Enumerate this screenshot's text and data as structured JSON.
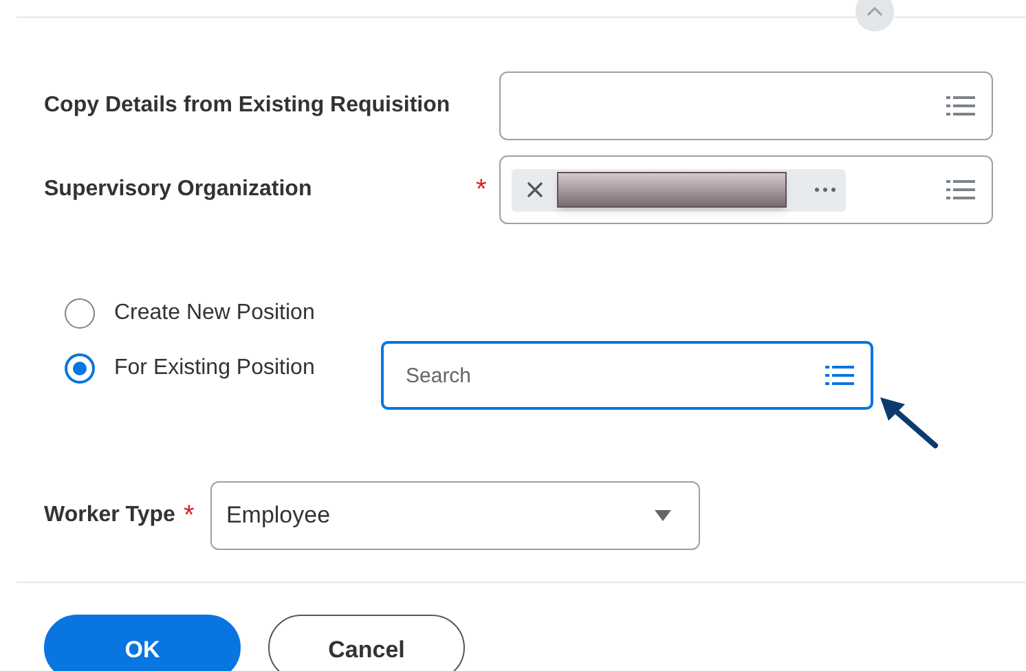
{
  "copy_details": {
    "label": "Copy Details from Existing Requisition"
  },
  "supervisory_org": {
    "label": "Supervisory Organization",
    "required_mark": "*"
  },
  "position_options": [
    {
      "label": "Create New Position",
      "selected": false
    },
    {
      "label": "For Existing Position",
      "selected": true
    }
  ],
  "position_search": {
    "placeholder": "Search",
    "focused": true
  },
  "worker_type": {
    "label": "Worker Type",
    "required_mark": "*",
    "value": "Employee"
  },
  "buttons": [
    {
      "label": "OK",
      "kind": "primary"
    },
    {
      "label": "Cancel",
      "kind": "secondary"
    }
  ]
}
